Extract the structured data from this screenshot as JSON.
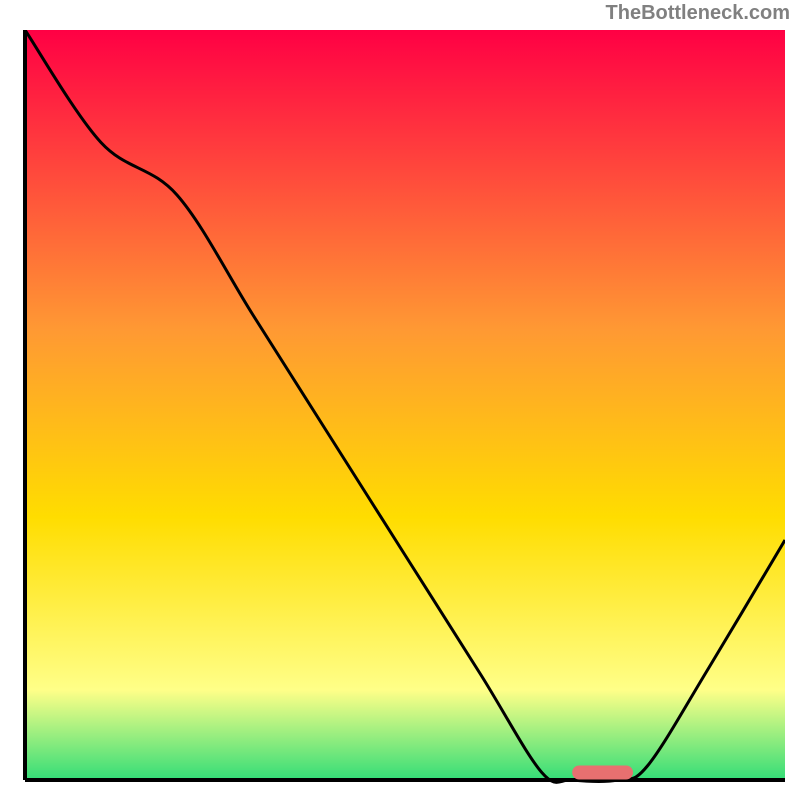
{
  "watermark": "TheBottleneck.com",
  "chart_data": {
    "type": "line",
    "title": "",
    "xlabel": "",
    "ylabel": "",
    "xlim": [
      0,
      100
    ],
    "ylim": [
      0,
      100
    ],
    "background_gradient": {
      "top": "#ff0044",
      "upper_mid": "#ff9933",
      "mid": "#ffdd00",
      "lower_mid": "#ffff88",
      "bottom": "#33dd77"
    },
    "curve": [
      {
        "x": 0,
        "y": 100
      },
      {
        "x": 10,
        "y": 85
      },
      {
        "x": 20,
        "y": 78
      },
      {
        "x": 30,
        "y": 62
      },
      {
        "x": 40,
        "y": 46
      },
      {
        "x": 50,
        "y": 30
      },
      {
        "x": 60,
        "y": 14
      },
      {
        "x": 68,
        "y": 1
      },
      {
        "x": 72,
        "y": 0
      },
      {
        "x": 78,
        "y": 0
      },
      {
        "x": 82,
        "y": 2
      },
      {
        "x": 90,
        "y": 15
      },
      {
        "x": 100,
        "y": 32
      }
    ],
    "marker": {
      "x_start": 72,
      "x_end": 80,
      "y": 1,
      "color": "#e87070"
    },
    "axes_color": "#000000"
  }
}
